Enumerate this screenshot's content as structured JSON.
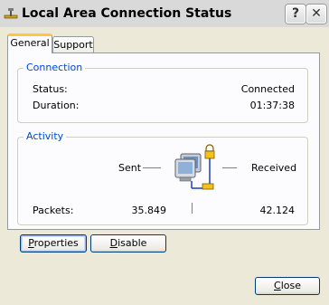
{
  "window": {
    "title": "Local Area Connection Status",
    "help_glyph": "?",
    "close_glyph": "✕",
    "title_icon": "network-connection-icon",
    "caption_color": "#d9d9d9",
    "body_color": "#ece9d8"
  },
  "tabs": [
    {
      "label": "General",
      "selected": true
    },
    {
      "label": "Support",
      "selected": false
    }
  ],
  "connection": {
    "heading": "Connection",
    "status_label": "Status:",
    "status_value": "Connected",
    "duration_label": "Duration:",
    "duration_value": "01:37:38",
    "heading_color": "#0046d5"
  },
  "activity": {
    "heading": "Activity",
    "sent_label": "Sent",
    "received_label": "Received",
    "packets_label": "Packets:",
    "packets_sent": "35.849",
    "packets_received": "42.124",
    "icon": "network-computers-icon"
  },
  "buttons": {
    "properties_accel": "P",
    "properties_rest": "roperties",
    "disable_accel": "D",
    "disable_rest": "isable",
    "close_accel": "C",
    "close_rest": "lose"
  }
}
